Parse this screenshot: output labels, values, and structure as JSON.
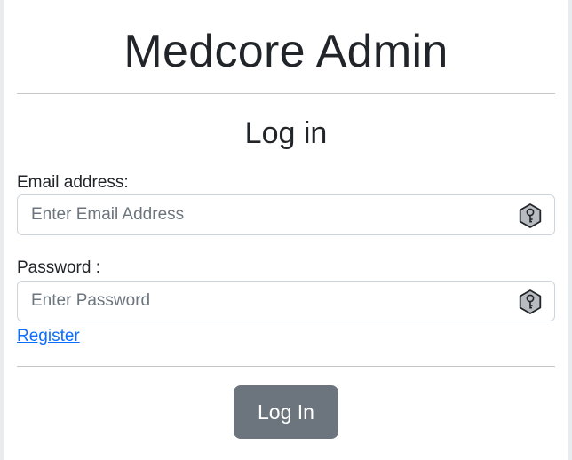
{
  "app": {
    "title": "Medcore Admin"
  },
  "form": {
    "title": "Log in",
    "email": {
      "label": "Email address:",
      "placeholder": "Enter Email Address",
      "value": "",
      "icon": "key-hexagon-icon"
    },
    "password": {
      "label": "Password :",
      "placeholder": "Enter Password",
      "value": "",
      "icon": "key-hexagon-icon"
    },
    "register_link": "Register",
    "submit_label": "Log In"
  },
  "colors": {
    "page_background": "#e9ecef",
    "card_background": "#ffffff",
    "text": "#212529",
    "link": "#0d6efd",
    "button_background": "#6c757d",
    "button_text": "#ffffff",
    "icon_fill": "#b8bcc1"
  }
}
